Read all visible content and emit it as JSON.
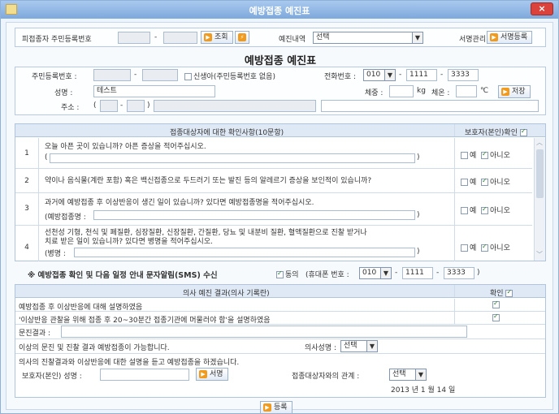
{
  "window": {
    "title": "예방접종 예진표",
    "close_label": "×"
  },
  "top": {
    "patient_rrn_label": "피접종자 주민등록번호",
    "dash": "-",
    "lookup_button": "조회",
    "history_label": "예진내역",
    "history_select": "선택",
    "sign_mgmt_label": "서명관리",
    "sign_register_button": "서명등록"
  },
  "form_title": "예방접종 예진표",
  "info": {
    "rrn_label": "주민등록번호 :",
    "newborn_label": "신생아(주민등록번호 없음)",
    "phone_label": "전화번호 :",
    "phone_area": "010",
    "phone_mid": "1111",
    "phone_last": "3333",
    "name_label": "성명 :",
    "name_value": "테스트",
    "weight_label": "체중 :",
    "weight_unit": "kg",
    "temp_label": "체온 :",
    "temp_unit": "℃",
    "save_button": "저장",
    "address_label": "주소 :",
    "paren_open": "(",
    "paren_close": ")"
  },
  "questions": {
    "header": "접종대상자에 대한 확인사항(10문항)",
    "guardian_header": "보호자(본인)확인",
    "yes_label": "예",
    "no_label": "아니오",
    "items": [
      {
        "num": "1",
        "text": "오늘 아픈 곳이 있습니까? 아픈 증상을 적어주십시오.",
        "prefix": "(",
        "suffix": ")"
      },
      {
        "num": "2",
        "text": "약이나 음식물(계란 포함) 혹은 백신접종으로 두드러기 또는 발진 등의 알레르기 증상을 보인적이 있습니까?"
      },
      {
        "num": "3",
        "text": "과거에 예방접종 후 이상반응이 생긴 일이 있습니까? 있다면 예방접종명을 적어주십시오.",
        "prefix": "(예방접종명 :",
        "suffix": ")"
      },
      {
        "num": "4",
        "text": "선천성 기형, 천식 및 폐질환, 심장질환, 신장질환, 간질환, 당뇨 및 내분비 질환, 혈액질환으로 진찰 받거나",
        "text2": "치료 받은 일이 있습니까? 있다면 병명을 적어주십시오.",
        "prefix": "(병명 :",
        "suffix": ")"
      }
    ]
  },
  "sms": {
    "label": "※ 예방접종 확인 및 다음 일정 안내 문자알림(SMS) 수신",
    "agree_label": "동의",
    "mobile_label": "(휴대폰 번호 :",
    "area": "010",
    "mid": "1111",
    "last": "3333",
    "close": ")"
  },
  "doctor": {
    "header": "의사 예진 결과(의사 기록란)",
    "confirm_header": "확인",
    "rows": [
      "예방접종 후 이상반응에 대해 설명하였음",
      "'이상반응 관찰을 위해 접종 후 20~30분간 접종기관에 머물러야 함'을 설명하였음"
    ],
    "result_label": "문진결과 :",
    "possible_text": "이상의 문진 및 진찰 결과 예방접종이 가능합니다.",
    "doctor_name_label": "의사성명 :",
    "doctor_select": "선택",
    "statement": "의사의 진찰결과와 이상반응에 대한 설명을 듣고 예방접종을 하겠습니다.",
    "guardian_name_label": "보호자(본인) 성명 :",
    "sign_button": "서명",
    "relation_label": "접종대상자와의 관계 :",
    "relation_select": "선택",
    "date_text": "2013 년   1 월   14 일"
  },
  "register_button": "등록"
}
